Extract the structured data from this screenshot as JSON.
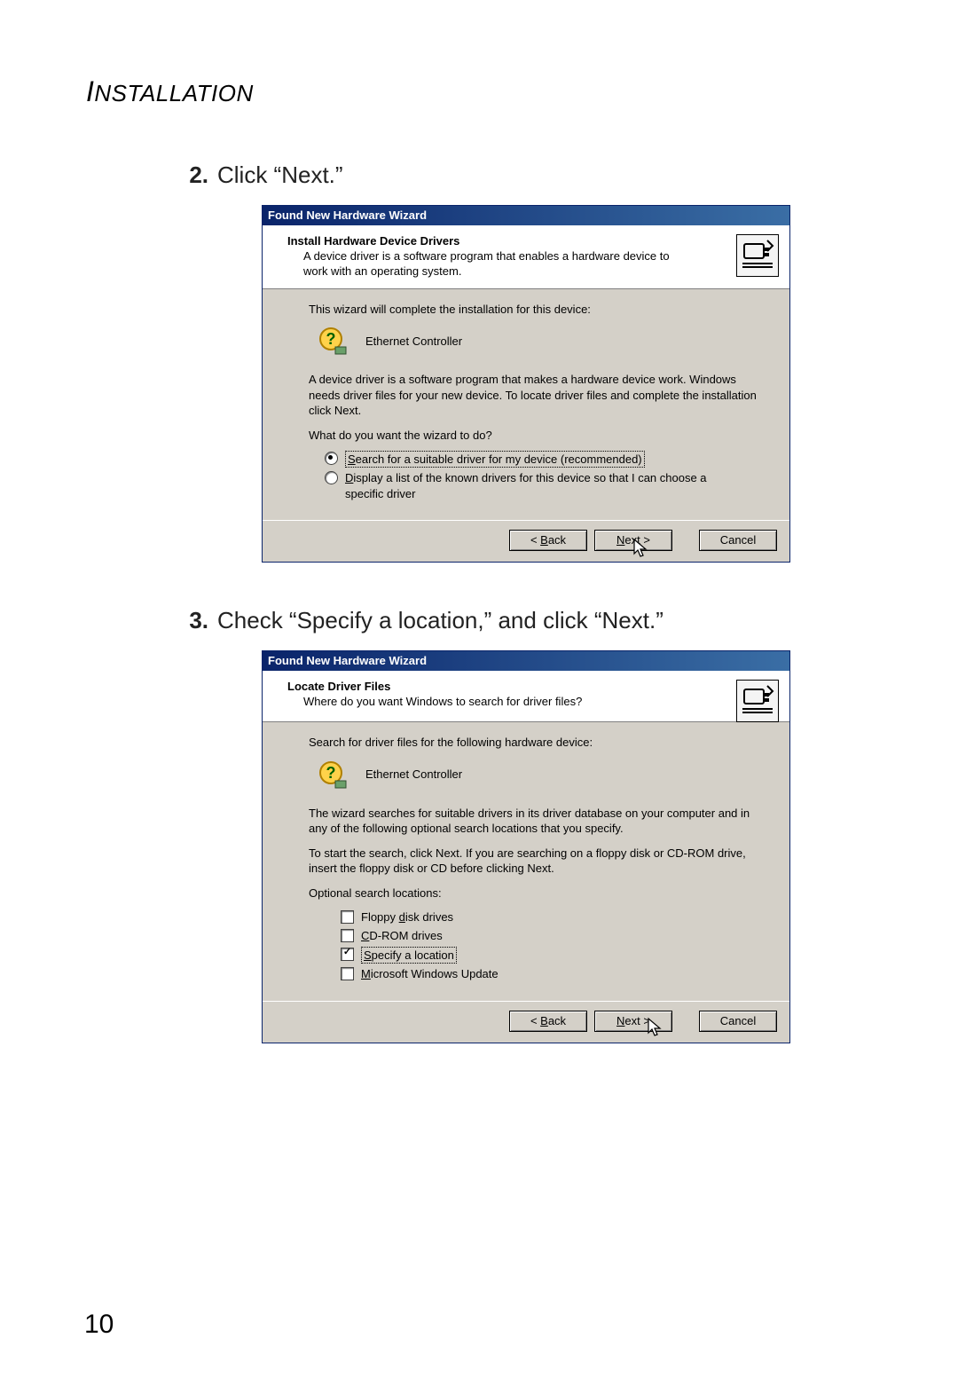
{
  "page": {
    "section_header": "INSTALLATION",
    "page_number": "10"
  },
  "steps": {
    "s2": {
      "num": "2.",
      "text": "Click “Next.”"
    },
    "s3": {
      "num": "3.",
      "text": "Check “Specify a location,” and click “Next.”"
    }
  },
  "dialog1": {
    "title": "Found New Hardware Wizard",
    "header_title": "Install Hardware Device Drivers",
    "header_sub": "A device driver is a software program that enables a hardware device to work with an operating system.",
    "line1": "This wizard will complete the installation for this device:",
    "device": "Ethernet Controller",
    "para": "A device driver is a software program that makes a hardware device work. Windows needs driver files for your new device. To locate driver files and complete the installation click Next.",
    "prompt": "What do you want the wizard to do?",
    "opt1": "Search for a suitable driver for my device (recommended)",
    "opt2": "Display a list of the known drivers for this device so that I can choose a specific driver",
    "back": "< Back",
    "next": "Next >",
    "cancel": "Cancel"
  },
  "dialog2": {
    "title": "Found New Hardware Wizard",
    "header_title": "Locate Driver Files",
    "header_sub": "Where do you want Windows to search for driver files?",
    "line1": "Search for driver files for the following hardware device:",
    "device": "Ethernet Controller",
    "para1": "The wizard searches for suitable drivers in its driver database on your computer and in any of the following optional search locations that you specify.",
    "para2": "To start the search, click Next. If you are searching on a floppy disk or CD-ROM drive, insert the floppy disk or CD before clicking Next.",
    "opt_label": "Optional search locations:",
    "chk1": "Floppy disk drives",
    "chk2": "CD-ROM drives",
    "chk3": "Specify a location",
    "chk4": "Microsoft Windows Update",
    "back": "< Back",
    "next": "Next >",
    "cancel": "Cancel"
  }
}
